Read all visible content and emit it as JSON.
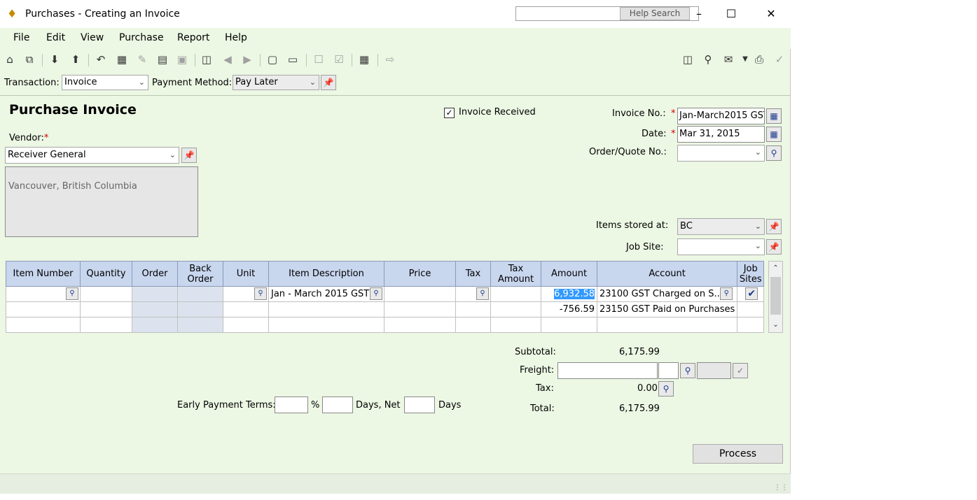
{
  "window": {
    "title": "Purchases - Creating an Invoice",
    "help_search_label": "Help Search"
  },
  "menu": [
    "File",
    "Edit",
    "View",
    "Purchase",
    "Report",
    "Help"
  ],
  "transaction": {
    "transaction_label": "Transaction:",
    "transaction_value": "Invoice",
    "payment_label": "Payment Method:",
    "payment_value": "Pay Later"
  },
  "form": {
    "heading": "Purchase Invoice",
    "vendor_label": "Vendor:",
    "vendor_value": "Receiver General",
    "vendor_address": "Vancouver, British Columbia",
    "invoice_received_label": "Invoice Received",
    "invoice_no_label": "Invoice No.:",
    "invoice_no_value": "Jan-March2015 GST",
    "date_label": "Date:",
    "date_value": "Mar 31, 2015",
    "order_quote_label": "Order/Quote No.:",
    "items_stored_label": "Items stored at:",
    "items_stored_value": "BC",
    "job_site_label": "Job Site:"
  },
  "grid": {
    "headers": {
      "item_number": "Item Number",
      "quantity": "Quantity",
      "order": "Order",
      "back_order": "Back Order",
      "unit": "Unit",
      "item_description": "Item Description",
      "price": "Price",
      "tax": "Tax",
      "tax_amount": "Tax Amount",
      "amount": "Amount",
      "account": "Account",
      "job_sites": "Job Sites"
    },
    "rows": [
      {
        "description": "Jan - March 2015 GST",
        "amount": "6,932.58",
        "account": "23100 GST Charged on S..."
      },
      {
        "description": "",
        "amount": "-756.59",
        "account": "23150 GST Paid on Purchases"
      }
    ]
  },
  "totals": {
    "subtotal_label": "Subtotal:",
    "subtotal_value": "6,175.99",
    "freight_label": "Freight:",
    "tax_label": "Tax:",
    "tax_value": "0.00",
    "total_label": "Total:",
    "total_value": "6,175.99"
  },
  "terms": {
    "label": "Early Payment Terms:",
    "percent": "%",
    "days_net": "Days,  Net",
    "days": "Days"
  },
  "process_label": "Process",
  "colors": {
    "window_bg": "#ecf7e4",
    "grid_header": "#c8d6ee",
    "selection": "#3399ff"
  }
}
